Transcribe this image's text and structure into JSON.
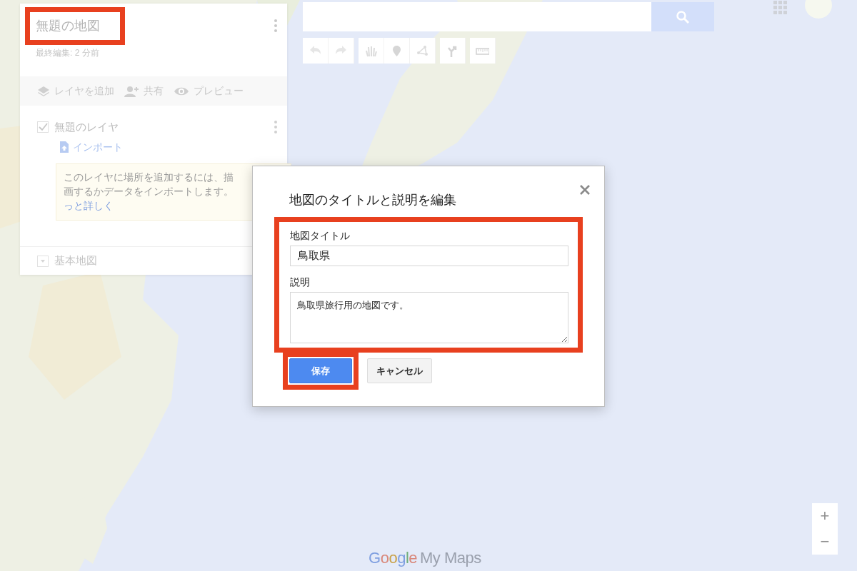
{
  "map_panel": {
    "title": "無題の地図",
    "title_highlighted": true,
    "subtitle": "最終編集: 2 分前",
    "actions": [
      {
        "kind": "layers",
        "label": "レイヤを追加"
      },
      {
        "kind": "share",
        "label": "共有"
      },
      {
        "kind": "preview",
        "label": "プレビュー"
      }
    ],
    "layers": [
      {
        "name": "無題のレイヤ",
        "checked": true,
        "import_link": "インポート",
        "hint_lines": [
          "このレイヤに場所を追加するには、描",
          "画するかデータをインポートします。"
        ],
        "hint_link": "っと詳しく"
      }
    ],
    "base_map": "基本地図"
  },
  "toolbar": [
    {
      "kind": "undo"
    },
    {
      "kind": "redo"
    },
    {
      "kind": "hand"
    },
    {
      "kind": "marker"
    },
    {
      "kind": "line"
    },
    {
      "kind": "route"
    },
    {
      "kind": "ruler"
    }
  ],
  "zoom": [
    "+",
    "−"
  ],
  "logo": {
    "brand": "Google",
    "product": "My Maps"
  },
  "dialog": {
    "title": "地図のタイトルと説明を編集",
    "fields_highlighted": true,
    "fields": [
      {
        "kind": "input",
        "label": "地図タイトル",
        "value": "鳥取県"
      },
      {
        "kind": "textarea",
        "label": "説明",
        "value": "鳥取県旅行用の地図です。"
      }
    ],
    "buttons": [
      {
        "kind": "primary",
        "label": "保存",
        "highlighted": true
      },
      {
        "kind": "secondary",
        "label": "キャンセル",
        "highlighted": false
      }
    ]
  }
}
